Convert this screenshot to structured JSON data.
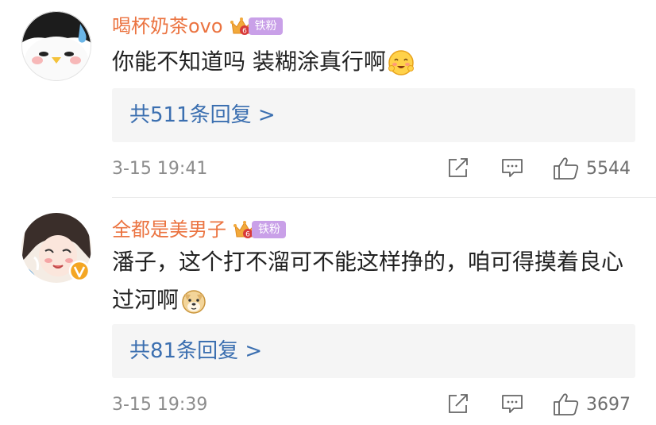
{
  "comments": [
    {
      "username": "喝杯奶茶ovo",
      "badge_label": "铁粉",
      "text": "你能不知道吗 装糊涂真行啊",
      "replies_label": "共511条回复 >",
      "time": "3-15 19:41",
      "likes": "5544"
    },
    {
      "username": "全都是美男子",
      "badge_label": "铁粉",
      "text": "潘子，这个打不溜可不能这样挣的，咱可得摸着良心过河啊",
      "replies_label": "共81条回复 >",
      "time": "3-15 19:39",
      "likes": "3697"
    }
  ],
  "icons": {
    "share": "share-icon",
    "comment": "comment-icon",
    "like": "thumbs-up-icon",
    "emoji1": "blushing-face-emoji",
    "emoji2": "doge-emoji",
    "verified": "verified-v-icon"
  },
  "colors": {
    "username": "#eb7340",
    "reply_link": "#3b6fb0",
    "badge": "#c9a0e8",
    "meta_text": "#8c8c8c",
    "reply_bg": "#f5f5f5"
  }
}
